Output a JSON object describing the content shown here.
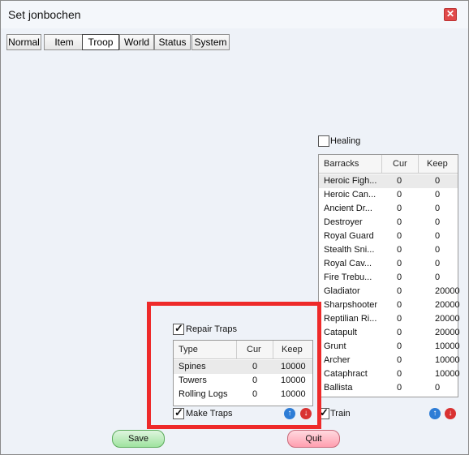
{
  "window": {
    "title": "Set jonbochen",
    "close_glyph": "✕"
  },
  "tabs": [
    {
      "label": "Normal"
    },
    {
      "label": "Item"
    },
    {
      "label": "Troop",
      "active": true
    },
    {
      "label": "World"
    },
    {
      "label": "Status"
    },
    {
      "label": "System"
    }
  ],
  "traps": {
    "repair_label": "Repair Traps",
    "repair_checked": true,
    "headers": [
      "Type",
      "Cur",
      "Keep"
    ],
    "rows": [
      {
        "type": "Spines",
        "cur": "0",
        "keep": "10000"
      },
      {
        "type": "Towers",
        "cur": "0",
        "keep": "10000"
      },
      {
        "type": "Rolling Logs",
        "cur": "0",
        "keep": "10000"
      }
    ],
    "make_label": "Make Traps",
    "make_checked": true
  },
  "barracks": {
    "healing_label": "Healing",
    "healing_checked": false,
    "headers": [
      "Barracks",
      "Cur",
      "Keep"
    ],
    "rows": [
      {
        "name": "Heroic Figh...",
        "cur": "0",
        "keep": "0"
      },
      {
        "name": "Heroic Can...",
        "cur": "0",
        "keep": "0"
      },
      {
        "name": "Ancient Dr...",
        "cur": "0",
        "keep": "0"
      },
      {
        "name": "Destroyer",
        "cur": "0",
        "keep": "0"
      },
      {
        "name": "Royal Guard",
        "cur": "0",
        "keep": "0"
      },
      {
        "name": "Stealth Sni...",
        "cur": "0",
        "keep": "0"
      },
      {
        "name": "Royal Cav...",
        "cur": "0",
        "keep": "0"
      },
      {
        "name": "Fire Trebu...",
        "cur": "0",
        "keep": "0"
      },
      {
        "name": "Gladiator",
        "cur": "0",
        "keep": "20000"
      },
      {
        "name": "Sharpshooter",
        "cur": "0",
        "keep": "20000"
      },
      {
        "name": "Reptilian Ri...",
        "cur": "0",
        "keep": "20000"
      },
      {
        "name": "Catapult",
        "cur": "0",
        "keep": "20000"
      },
      {
        "name": "Grunt",
        "cur": "0",
        "keep": "10000"
      },
      {
        "name": "Archer",
        "cur": "0",
        "keep": "10000"
      },
      {
        "name": "Cataphract",
        "cur": "0",
        "keep": "10000"
      },
      {
        "name": "Ballista",
        "cur": "0",
        "keep": "0"
      }
    ],
    "train_label": "Train",
    "train_checked": true
  },
  "buttons": {
    "save": "Save",
    "quit": "Quit"
  },
  "arrows": {
    "up": "↑",
    "down": "↓"
  },
  "colors": {
    "highlight": "#ee2a2a",
    "save": "#9fe39f",
    "quit": "#ff9fb0",
    "up": "#2e7dd6",
    "down": "#d93232"
  }
}
